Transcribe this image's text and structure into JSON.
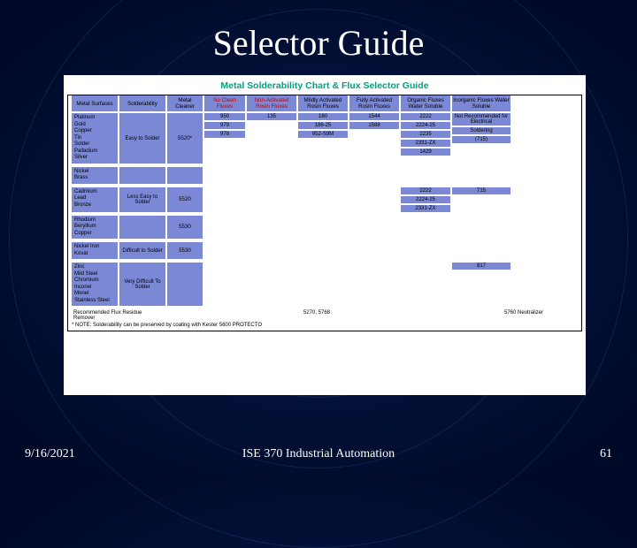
{
  "slide": {
    "title": "Selector Guide",
    "date": "9/16/2021",
    "course": "ISE 370 Industrial Automation",
    "page": "61"
  },
  "chart": {
    "title": "Metal Solderability Chart & Flux Selector Guide",
    "headers": {
      "metal_surfaces": "Metal Surfaces",
      "solderability": "Solderability",
      "metal_cleaner": "Metal Cleaner",
      "no_clean": "No Clean Fluxes",
      "non_activated": "Non-Activated Rosin Fluxes",
      "mildly_activated": "Mildly Activated Rosin Fluxes",
      "fully_activated": "Fully Activated Rosin Fluxes",
      "organic": "Organic Fluxes Water Soluble",
      "inorganic": "Inorganic Fluxes Water Soluble"
    },
    "groups": [
      {
        "metals": "Platinum\nGold\nCopper\nTin\nSolder\nPalladium\nSilver",
        "sold": "Easy to Solder",
        "cleaner": "5520*",
        "noclean": [
          "950",
          "979",
          "978"
        ],
        "nonact": [
          "135"
        ],
        "mild": [
          "180",
          "186-25",
          "952-S9M"
        ],
        "full": [
          "1544",
          "1588"
        ],
        "organic": [
          "2222",
          "2224-25",
          "2235",
          "2331-ZX",
          "1429"
        ],
        "inorganic": [
          "Not Recommended for Electrical",
          "Soldering",
          "(715)"
        ]
      },
      {
        "metals": "Nickel\nBrass",
        "sold": "",
        "cleaner": "",
        "noclean": [],
        "nonact": [],
        "mild": [],
        "full": [],
        "organic": [],
        "inorganic": []
      },
      {
        "metals": "Cadmium\nLead\nBronze",
        "sold": "Less Easy to Solder",
        "cleaner": "5520",
        "noclean": [],
        "nonact": [],
        "mild": [],
        "full": [],
        "organic": [
          "2222",
          "2224-25",
          "2331-ZX"
        ],
        "inorganic": [
          "715"
        ]
      },
      {
        "metals": "Rhodium\nBeryllium\nCopper",
        "sold": "",
        "cleaner": "5530",
        "noclean": [],
        "nonact": [],
        "mild": [],
        "full": [],
        "organic": [],
        "inorganic": []
      },
      {
        "metals": "Nickel Iron\nKovar",
        "sold": "Difficult to Solder",
        "cleaner": "5530",
        "noclean": [],
        "nonact": [],
        "mild": [],
        "full": [],
        "organic": [],
        "inorganic": []
      },
      {
        "metals": "Zinc\nMild Steel\nChromium\nInconel\nMonel\nStainless Steel",
        "sold": "Very Difficult To Solder",
        "cleaner": "",
        "noclean": [],
        "nonact": [],
        "mild": [],
        "full": [],
        "organic": [],
        "inorganic": [
          "817"
        ]
      }
    ],
    "footer": {
      "label": "Recommended Flux Residue Remover",
      "mid": "5270, 5768",
      "right": "5760 Neutralizer"
    },
    "note": "* NOTE: Solderability can be preserved by coating with Kester 5600 PROTECTO"
  }
}
